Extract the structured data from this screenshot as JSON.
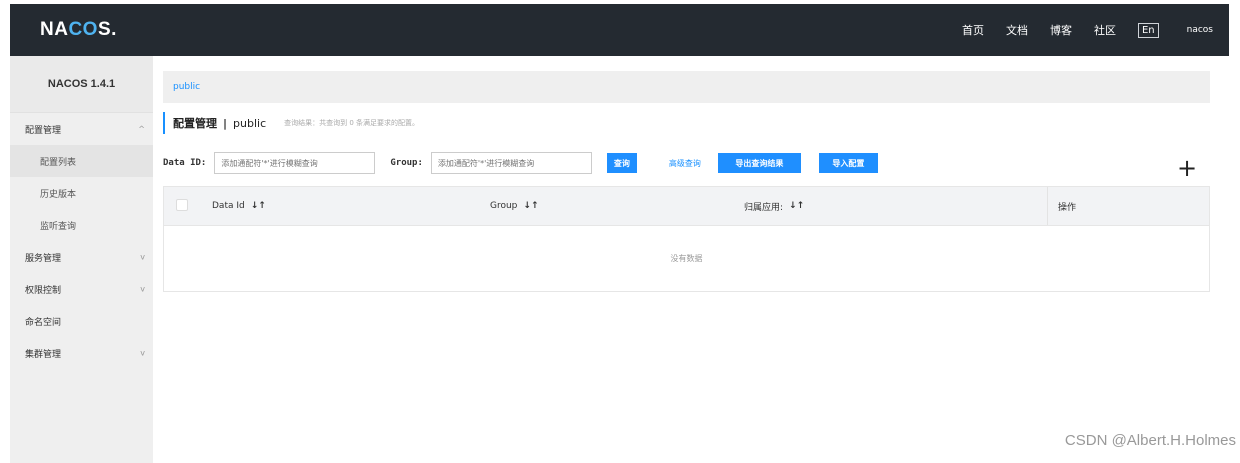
{
  "header": {
    "logo_main": "NA",
    "logo_accent": "CO",
    "logo_tail": "S.",
    "nav": [
      "首页",
      "文档",
      "博客",
      "社区"
    ],
    "lang": "En",
    "user": "nacos"
  },
  "sidebar": {
    "version": "NACOS 1.4.1",
    "items": [
      {
        "label": "配置管理",
        "chevron": "^"
      },
      {
        "label": "配置列表"
      },
      {
        "label": "历史版本"
      },
      {
        "label": "监听查询"
      },
      {
        "label": "服务管理",
        "chevron": "v"
      },
      {
        "label": "权限控制",
        "chevron": "v"
      },
      {
        "label": "命名空间"
      },
      {
        "label": "集群管理",
        "chevron": "v"
      }
    ]
  },
  "breadcrumb": {
    "namespace": "public"
  },
  "title": {
    "main": "配置管理",
    "sep": "|",
    "namespace": "public",
    "hint": "查询结果：共查询到 0 条满足要求的配置。"
  },
  "filters": {
    "data_id_label": "Data ID:",
    "data_id_placeholder": "添加通配符'*'进行模糊查询",
    "group_label": "Group:",
    "group_placeholder": "添加通配符'*'进行模糊查询",
    "query_button": "查询",
    "advanced_link": "高级查询",
    "export_button": "导出查询结果",
    "import_button": "导入配置"
  },
  "add_icon": "+",
  "table": {
    "columns": [
      "Data Id",
      "Group",
      "归属应用:",
      "操作"
    ],
    "sort_icon": "↓↑",
    "empty_text": "没有数据"
  },
  "watermark": "CSDN @Albert.H.Holmes"
}
